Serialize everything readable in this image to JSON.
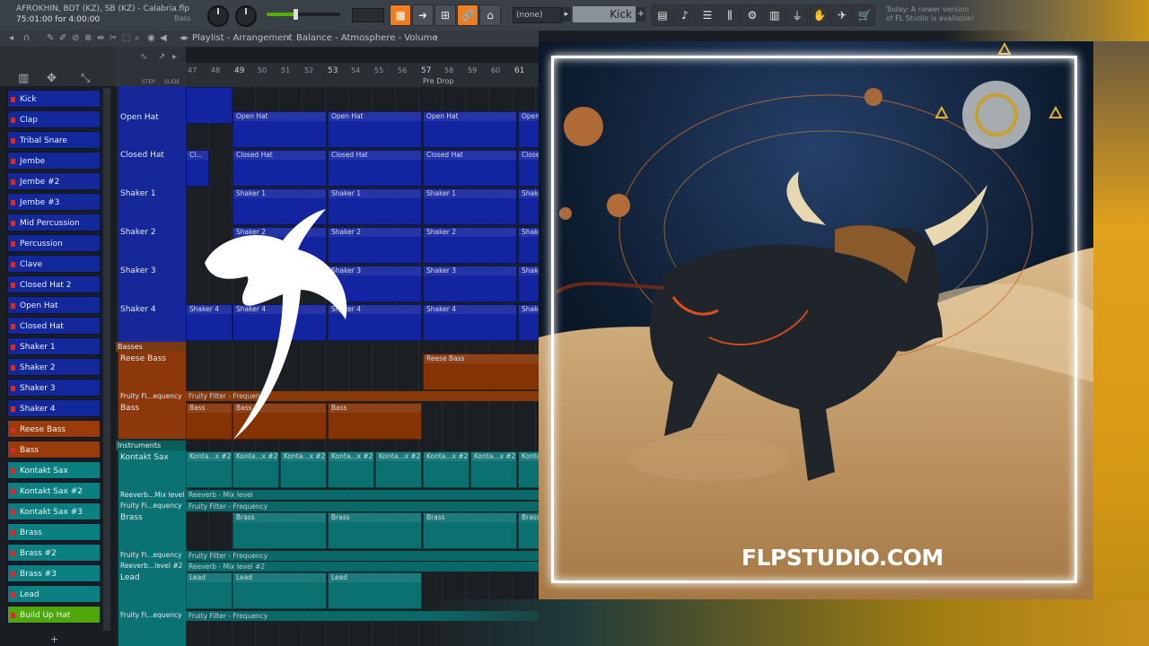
{
  "window": {
    "title": "AFROKHIN, BDT (KZ), SB (KZ) - Calabria.flp",
    "time": "75:01:00 for 4:00:00",
    "knob_label": "Bass"
  },
  "toolbar": {
    "pattern_none": "(none)",
    "pattern_name": "Kick",
    "notice_line1": "Today: A newer version",
    "notice_line2": "of FL Studio is available!"
  },
  "playlist": {
    "breadcrumb": "Playlist - Arrangement",
    "breadcrumb_sep": "›",
    "automation": "Balance - Atmosphere - Volume",
    "step_label": "STEP",
    "slide_label": "SLIDE"
  },
  "ruler": {
    "bars": [
      "47",
      "48",
      "49",
      "50",
      "51",
      "52",
      "53",
      "54",
      "55",
      "56",
      "57",
      "58",
      "59",
      "60",
      "61"
    ],
    "marker": "Pre Drop"
  },
  "channels": [
    {
      "name": "Kick",
      "color": "blue"
    },
    {
      "name": "Clap",
      "color": "blue"
    },
    {
      "name": "Tribal Snare",
      "color": "blue"
    },
    {
      "name": "Jembe",
      "color": "blue"
    },
    {
      "name": "Jembe #2",
      "color": "blue"
    },
    {
      "name": "Jembe #3",
      "color": "blue"
    },
    {
      "name": "Mid Percussion",
      "color": "blue"
    },
    {
      "name": "Percussion",
      "color": "blue"
    },
    {
      "name": "Clave",
      "color": "blue"
    },
    {
      "name": "Closed Hat 2",
      "color": "blue"
    },
    {
      "name": "Open Hat",
      "color": "blue"
    },
    {
      "name": "Closed Hat",
      "color": "blue"
    },
    {
      "name": "Shaker 1",
      "color": "blue"
    },
    {
      "name": "Shaker 2",
      "color": "blue"
    },
    {
      "name": "Shaker 3",
      "color": "blue"
    },
    {
      "name": "Shaker 4",
      "color": "blue"
    },
    {
      "name": "Reese Bass",
      "color": "brown"
    },
    {
      "name": "Bass",
      "color": "brown"
    },
    {
      "name": "Kontakt Sax",
      "color": "teal"
    },
    {
      "name": "Kontakt Sax #2",
      "color": "teal"
    },
    {
      "name": "Kontakt Sax #3",
      "color": "teal"
    },
    {
      "name": "Brass",
      "color": "teal"
    },
    {
      "name": "Brass #2",
      "color": "teal"
    },
    {
      "name": "Brass #3",
      "color": "teal"
    },
    {
      "name": "Lead",
      "color": "teal"
    },
    {
      "name": "Build Up Hat",
      "color": "green"
    }
  ],
  "channel_add": "+",
  "groups": {
    "basses": "Basses",
    "instruments": "Instruments"
  },
  "tracks": {
    "open_hat": "Open Hat",
    "closed_hat": "Closed Hat",
    "shaker1": "Shaker 1",
    "shaker2": "Shaker 2",
    "shaker3": "Shaker 3",
    "shaker4": "Shaker 4",
    "reese_bass": "Reese Bass",
    "fruity_freq": "Fruity Fi...equency",
    "bass": "Bass",
    "kontakt_sax": "Kontakt Sax",
    "reverb_mix": "Reeverb...Mix level",
    "fruity_freq2": "Fruity Fi...equency",
    "brass": "Brass",
    "fruity_freq3": "Fruity Fi...equency",
    "reverb_mix2": "Reeverb...level #2",
    "lead": "Lead",
    "fruity_freq4": "Fruity Fi...equency"
  },
  "clips": {
    "open_hat": "Open Hat",
    "closed_hat": "Closed Hat",
    "closed_hat_short": "Cl...",
    "shaker1": "Shaker 1",
    "shaker2": "Shaker 2",
    "shaker3": "Shaker 3",
    "shaker4": "Shaker 4",
    "reese_bass": "Reese Bass",
    "fruity_filter": "Fruity Filter - Frequency",
    "bass": "Bass",
    "kontakt": "Konta...x #2",
    "reverb": "Reeverb - Mix level",
    "brass": "Brass",
    "reverb2": "Reeverb - Mix level #2",
    "lead": "Lead"
  },
  "artwork": {
    "url_text": "FLPSTUDIO.COM",
    "frame_color": "#ffffff"
  },
  "colors": {
    "accent_orange": "#f07c1e",
    "track_blue": "#13289a",
    "track_brown": "#9a3b0a",
    "track_teal": "#0a8080",
    "track_green": "#4ea80a"
  }
}
